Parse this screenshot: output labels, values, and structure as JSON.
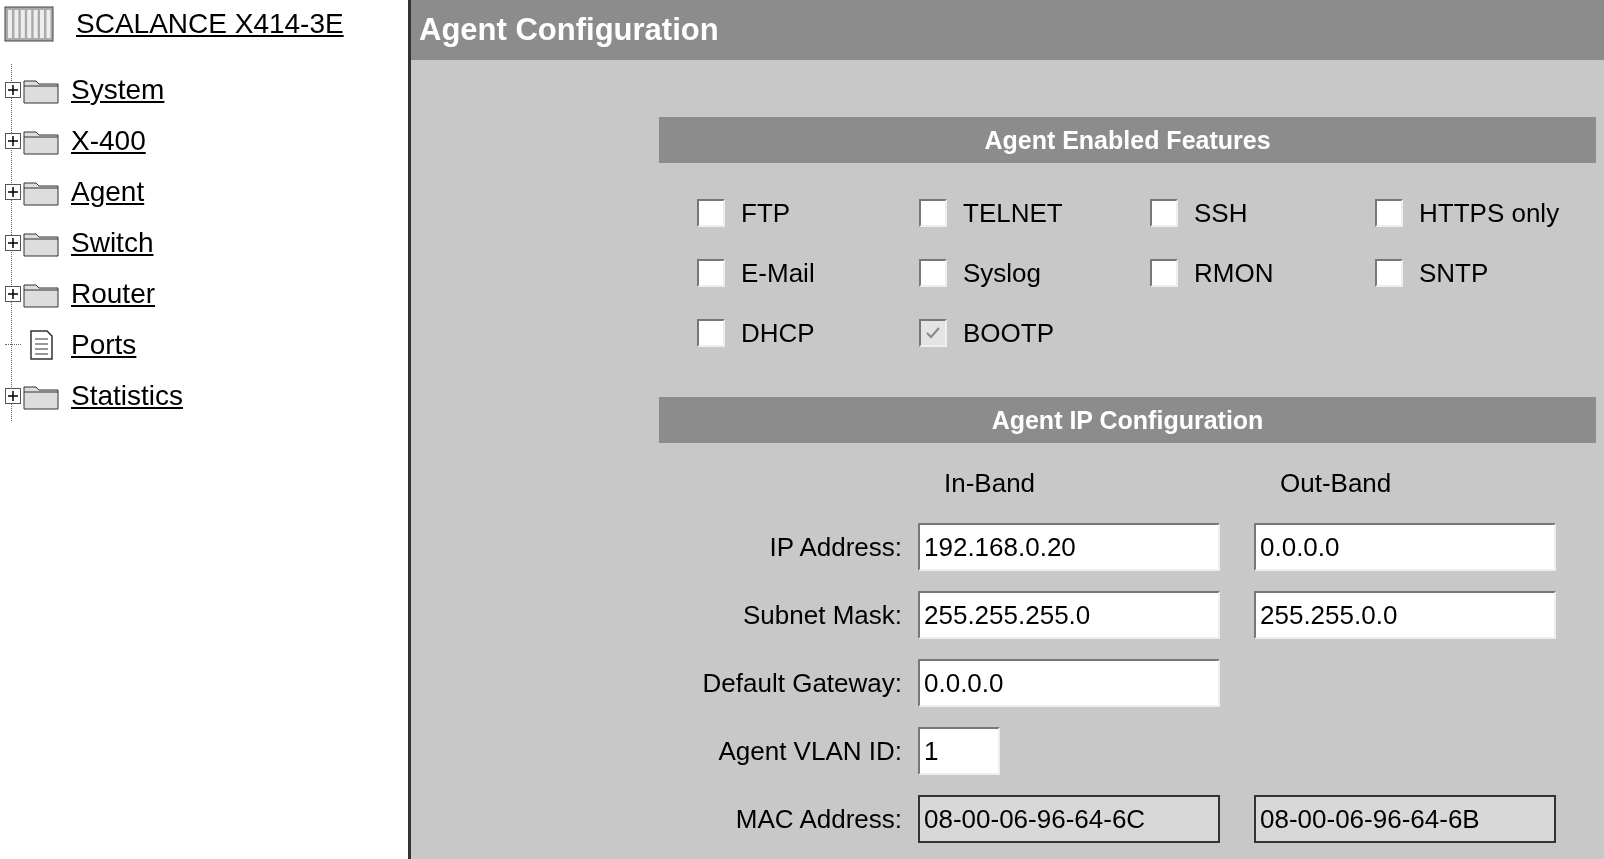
{
  "device": {
    "title": "SCALANCE X414-3E"
  },
  "tree": [
    {
      "label": "System",
      "kind": "folder"
    },
    {
      "label": "X-400",
      "kind": "folder"
    },
    {
      "label": "Agent",
      "kind": "folder"
    },
    {
      "label": "Switch",
      "kind": "folder"
    },
    {
      "label": "Router",
      "kind": "folder"
    },
    {
      "label": "Ports",
      "kind": "page"
    },
    {
      "label": "Statistics",
      "kind": "folder"
    }
  ],
  "header": {
    "title": "Agent Configuration"
  },
  "features": {
    "title": "Agent Enabled Features",
    "items": [
      {
        "label": "FTP",
        "checked": false,
        "disabled": false
      },
      {
        "label": "TELNET",
        "checked": false,
        "disabled": false
      },
      {
        "label": "SSH",
        "checked": false,
        "disabled": false
      },
      {
        "label": "HTTPS only",
        "checked": false,
        "disabled": false
      },
      {
        "label": "E-Mail",
        "checked": false,
        "disabled": false
      },
      {
        "label": "Syslog",
        "checked": false,
        "disabled": false
      },
      {
        "label": "RMON",
        "checked": false,
        "disabled": false
      },
      {
        "label": "SNTP",
        "checked": false,
        "disabled": false
      },
      {
        "label": "DHCP",
        "checked": false,
        "disabled": false
      },
      {
        "label": "BOOTP",
        "checked": true,
        "disabled": true
      }
    ]
  },
  "ip": {
    "title": "Agent IP Configuration",
    "columns": [
      "In-Band",
      "Out-Band"
    ],
    "rows": [
      {
        "label": "IP Address:",
        "kind": "field",
        "values": [
          "192.168.0.20",
          "0.0.0.0"
        ]
      },
      {
        "label": "Subnet Mask:",
        "kind": "field",
        "values": [
          "255.255.255.0",
          "255.255.0.0"
        ]
      },
      {
        "label": "Default Gateway:",
        "kind": "field",
        "values": [
          "0.0.0.0"
        ]
      },
      {
        "label": "Agent VLAN ID:",
        "kind": "short",
        "values": [
          "1"
        ]
      },
      {
        "label": "MAC Address:",
        "kind": "readonly",
        "values": [
          "08-00-06-96-64-6C",
          "08-00-06-96-64-6B"
        ]
      }
    ]
  }
}
